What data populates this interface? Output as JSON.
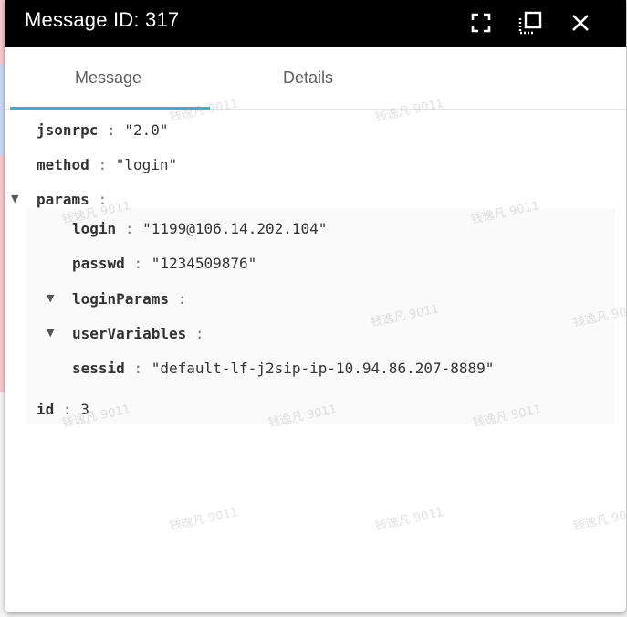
{
  "window": {
    "title": "Message ID: 317"
  },
  "titlebar_icons": {
    "fullscreen": "fullscreen-icon",
    "restore": "restore-window-icon",
    "close": "close-icon"
  },
  "tabs": [
    {
      "label": "Message",
      "active": true
    },
    {
      "label": "Details",
      "active": false
    }
  ],
  "colors": {
    "titlebar": "#000000",
    "accent": "#2ab7c7"
  },
  "json_tree": {
    "jsonrpc": {
      "key": "jsonrpc",
      "value": "\"2.0\""
    },
    "method": {
      "key": "method",
      "value": "\"login\""
    },
    "params": {
      "key": "params"
    },
    "login": {
      "key": "login",
      "value": "\"1199@106.14.202.104\""
    },
    "passwd": {
      "key": "passwd",
      "value": "\"1234509876\""
    },
    "loginParams": {
      "key": "loginParams"
    },
    "userVariables": {
      "key": "userVariables"
    },
    "sessid": {
      "key": "sessid",
      "value": "\"default-lf-j2sip-ip-10.94.86.207-8889\""
    },
    "id": {
      "key": "id",
      "value": "3"
    }
  },
  "separator": ":",
  "watermark_text": "钱逸凡 9011"
}
